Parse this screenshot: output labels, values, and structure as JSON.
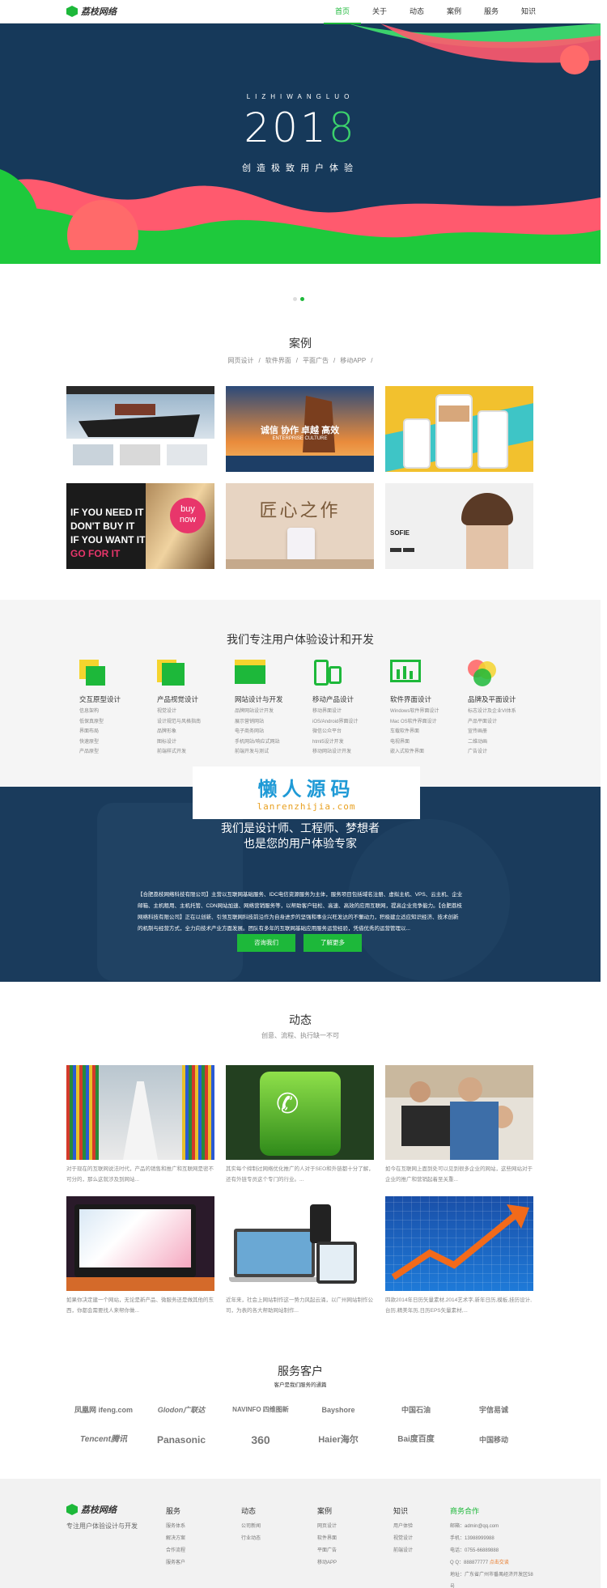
{
  "header": {
    "logo_text": "荔枝网络",
    "nav": [
      "首页",
      "关于",
      "动态",
      "案例",
      "服务",
      "知识"
    ]
  },
  "hero": {
    "subtitle": "LIZHIWANGLUO",
    "year_main": "201",
    "year_last": "8",
    "tagline": "创造极致用户体验"
  },
  "cases": {
    "title": "案例",
    "filters": [
      "网页设计",
      "/",
      "软件界面",
      "/",
      "平面广告",
      "/",
      "移动APP",
      "/"
    ],
    "thumb2_text": "诚信 协作 卓越 高效",
    "thumb2_text2": "ENTERPRISE CULTURE",
    "thumb4_lines": [
      "IF YOU NEED IT",
      "DON'T BUY IT",
      "IF YOU WANT IT",
      "GO FOR IT"
    ],
    "thumb4_badge1": "buy",
    "thumb4_badge2": "now",
    "thumb5_text": "匠心之作",
    "thumb6_text": "SOFIE"
  },
  "services": {
    "title": "我们专注用户体验设计和开发",
    "items": [
      {
        "title": "交互原型设计",
        "sub": [
          "信息架构",
          "低保真原型",
          "界面布局",
          "快速原型",
          "产品原型"
        ]
      },
      {
        "title": "产品视觉设计",
        "sub": [
          "视觉设计",
          "设计规范与风格指南",
          "品牌形象",
          "图标设计",
          "前端样式开发"
        ]
      },
      {
        "title": "网站设计与开发",
        "sub": [
          "品牌网站设计开发",
          "展示营销网站",
          "电子商务网站",
          "手机网站/响应式网站",
          "前端开发与测试"
        ]
      },
      {
        "title": "移动产品设计",
        "sub": [
          "移动界面设计",
          "iOS/Android界面设计",
          "微信公众平台",
          "html5设计开发",
          "移动网站设计开发"
        ]
      },
      {
        "title": "软件界面设计",
        "sub": [
          "Windows软件界面设计",
          "Mac OS软件界面设计",
          "车载软件界面",
          "电视界面",
          "嵌入式软件界面"
        ]
      },
      {
        "title": "品牌及平面设计",
        "sub": [
          "标志设计及企业VI体系",
          "产品平面设计",
          "宣传画册",
          "二维动画",
          "广告设计"
        ]
      }
    ]
  },
  "watermark": {
    "line1": "懒人源码",
    "line2": "lanrenzhijia.com"
  },
  "about": {
    "line1": "我们是设计师、工程师、梦想者",
    "line2": "也是您的用户体验专家",
    "para": "【合肥荔枝网络科技有限公司】主营以互联网基础服务、IDC电信资源服务为主体，服务项目包括域名注册、虚拟主机、VPS、云主机、企业邮箱、主机租用、主机托管、CDN网站加速、网络营销服务等，以帮助客户轻松、高速、高效的应用互联网，提高企业竞争能力。【合肥荔枝网络科技有限公司】正在以创新、引领互联网科技前沿作为自身进步的坚强和事业兴旺发达的不懈动力，积极建立适应知识经济、技术创新的机制与经营方式，全力向技术产业方面发展。团队有多年的互联网基础应用服务运营经验，凭借优秀的运营管理以...",
    "btn1": "咨询我们",
    "btn2": "了解更多"
  },
  "news": {
    "title": "动态",
    "subtitle": "创意、流程、执行缺一不可",
    "items": [
      "对于现在的互联网说法时代，产品的销售和推广和互联网是密不可分的，那么这就涉及到网站...",
      "其实每个缔制过网络优化推广的人对于SEO和外链都十分了解，还有外链专员这个专门的行业。...",
      "如今在互联网上面到处可以见到很多企业的网站，这些网站对于企业的推广和营销起着至关重...",
      "如果你决定建一个网站，无论是新产品、微服务还是做其他的东西，你都会需要找人来帮你做...",
      "近年来，社会上网站制作这一势力风起云涌，以广州网站制作公司，为表的各大帮助网站制作...",
      "四款2014年日历矢量素材,2014艺术字,新年日历,模板,挂历设计,台历,精美年历,日历EPS矢量素材,..."
    ]
  },
  "clients": {
    "title": "服务客户",
    "subtitle": "客户是我们服务的通篇",
    "logos": [
      "凤凰网 ifeng.com",
      "Glodon广联达",
      "NAVINFO 四维图新",
      "Bayshore",
      "中国石油",
      "宇信易诚",
      "Tencent腾讯",
      "Panasonic",
      "360",
      "Haier海尔",
      "Bai度百度",
      "中国移动"
    ]
  },
  "footer": {
    "logo_text": "荔枝网络",
    "tagline": "专注用户体验设计与开发",
    "cols": [
      {
        "h": "服务",
        "items": [
          "服务体系",
          "解决方案",
          "合作流程",
          "服务客户"
        ]
      },
      {
        "h": "动态",
        "items": [
          "公司新闻",
          "行业动态"
        ]
      },
      {
        "h": "案例",
        "items": [
          "网页设计",
          "软件界面",
          "平面广告",
          "移动APP"
        ]
      },
      {
        "h": "知识",
        "items": [
          "用户体验",
          "视觉设计",
          "前端设计"
        ]
      }
    ],
    "contact": {
      "h": "商务合作",
      "items": [
        "邮箱：admin@qq.com",
        "手机：13988999988",
        "电话：0755-66889888",
        "Q Q：888877777",
        "地址：广东省广州市番禺经济开发区58号"
      ],
      "qq_badge": "点击交谈"
    }
  },
  "colors": {
    "accent": "#1db83a",
    "hero_bg": "#16395a",
    "about_bg": "#1a3b5c"
  }
}
